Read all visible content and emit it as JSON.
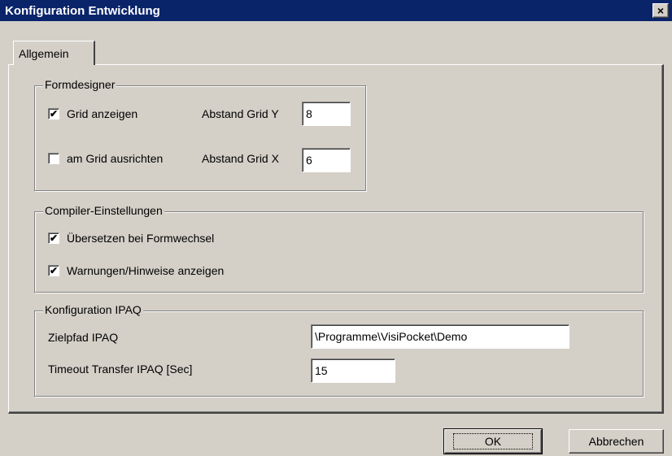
{
  "window": {
    "title": "Konfiguration Entwicklung",
    "close_glyph": "×"
  },
  "tabs": [
    {
      "label": "Allgemein",
      "active": true
    }
  ],
  "formdesigner": {
    "title": "Formdesigner",
    "grid_anzeigen": {
      "label": "Grid anzeigen",
      "checked": true
    },
    "am_grid_ausrichten": {
      "label": "am Grid ausrichten",
      "checked": false
    },
    "abstand_y": {
      "label": "Abstand Grid Y",
      "value": "8"
    },
    "abstand_x": {
      "label": "Abstand Grid X",
      "value": "6"
    }
  },
  "compiler": {
    "title": "Compiler-Einstellungen",
    "uebersetzen": {
      "label": "Übersetzen bei Formwechsel",
      "checked": true
    },
    "warnungen": {
      "label": "Warnungen/Hinweise anzeigen",
      "checked": true
    }
  },
  "ipaq": {
    "title": "Konfiguration IPAQ",
    "zielpfad": {
      "label": "Zielpfad IPAQ",
      "value": "\\Programme\\VisiPocket\\Demo"
    },
    "timeout": {
      "label": "Timeout Transfer IPAQ [Sec]",
      "value": "15"
    }
  },
  "buttons": {
    "ok": "OK",
    "cancel": "Abbrechen"
  },
  "check_glyph": "✔"
}
